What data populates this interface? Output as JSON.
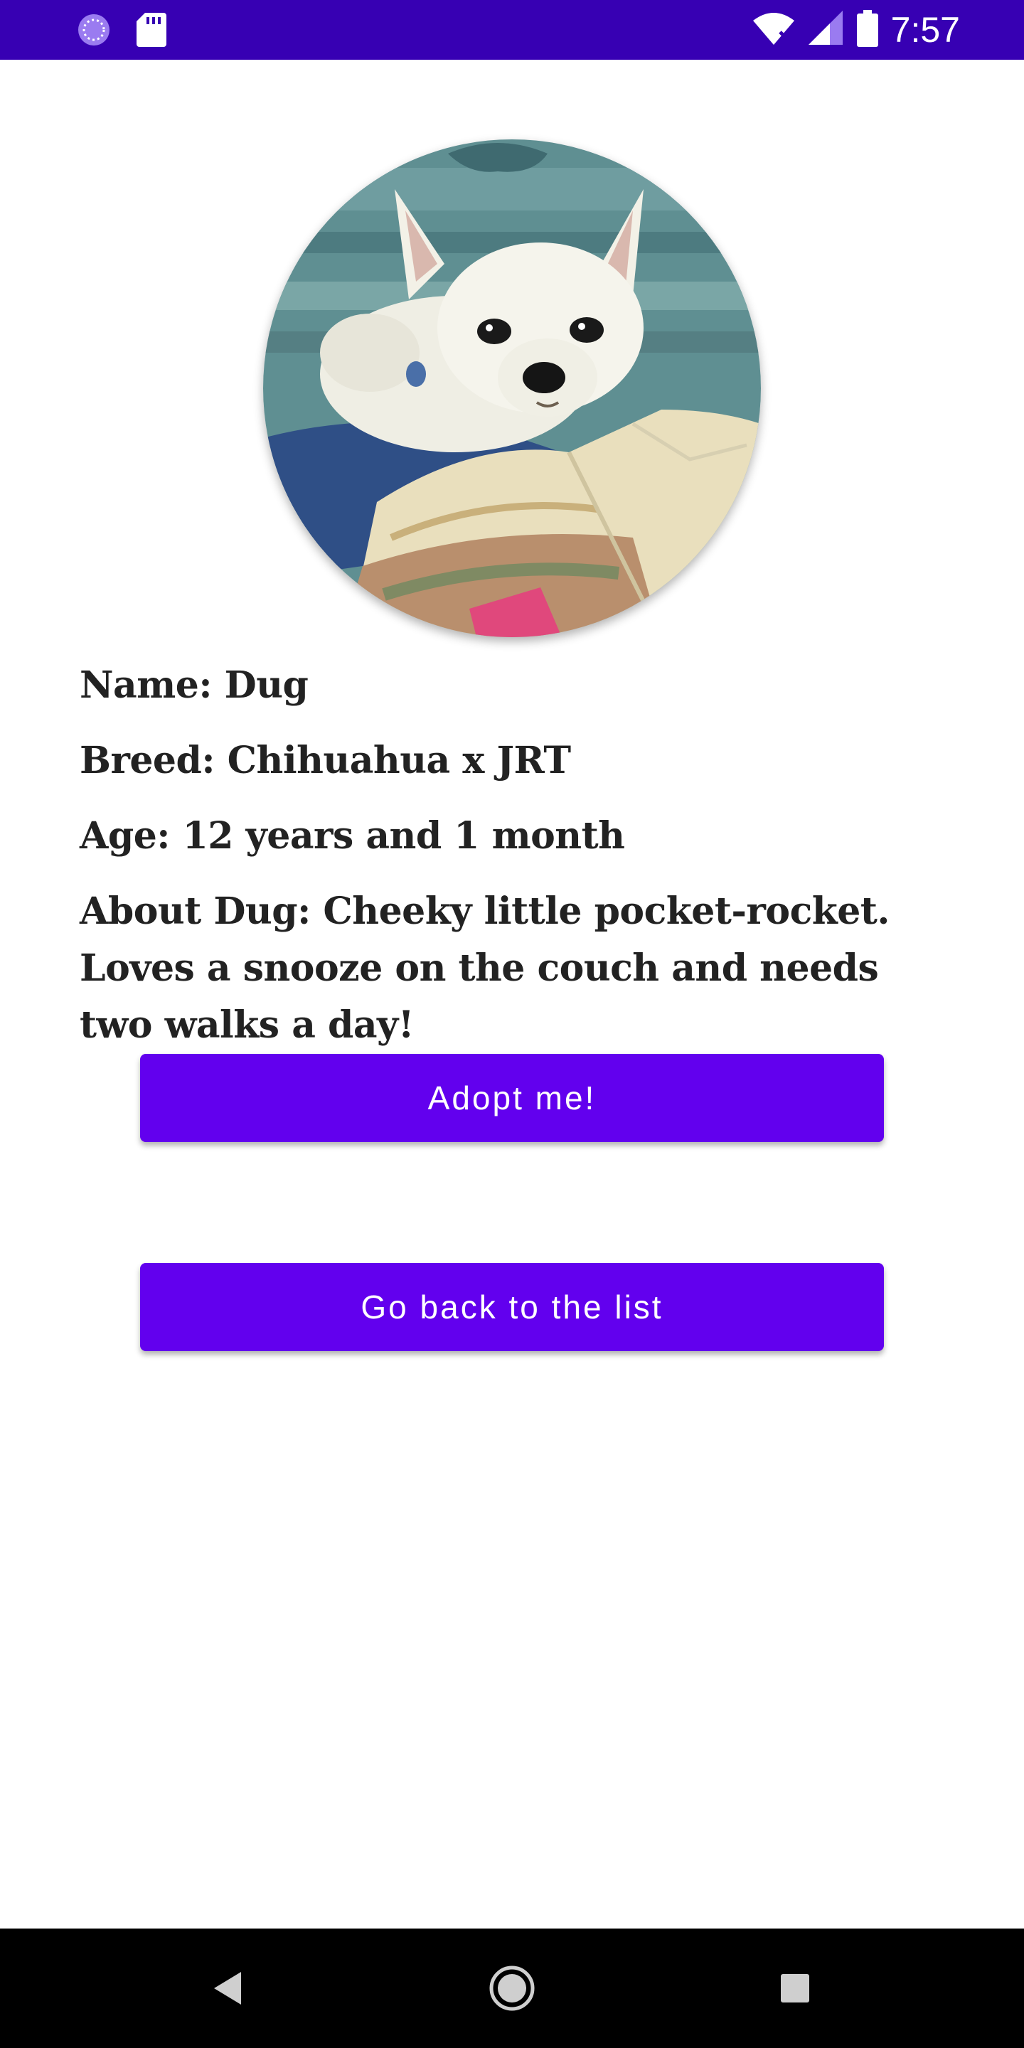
{
  "status_bar": {
    "time": "7:57",
    "icons": [
      "sync-icon",
      "sd-card-icon",
      "wifi-no-internet-icon",
      "cell-signal-icon",
      "battery-icon"
    ],
    "background_color": "#3700b3"
  },
  "pet": {
    "photo_alt": "dog-photo",
    "name_line": "Name: Dug",
    "breed_line": "Breed: Chihuahua x JRT",
    "age_line": "Age: 12 years and 1 month",
    "about_line": "About Dug: Cheeky little pocket-rocket. Loves a snooze on the couch and needs two walks a day!"
  },
  "actions": {
    "adopt_label": "Adopt me!",
    "back_label": "Go back to the list",
    "button_color": "#6200ee"
  },
  "nav_bar": {
    "icons": [
      "back-triangle-icon",
      "home-circle-icon",
      "recents-square-icon"
    ]
  }
}
